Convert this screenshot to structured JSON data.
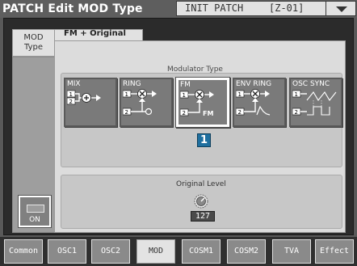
{
  "window": {
    "title": "PATCH Edit MOD Type",
    "patch_name": "INIT PATCH",
    "patch_number": "[Z-01]"
  },
  "side_tab": {
    "label_line1": "MOD",
    "label_line2": "Type"
  },
  "main_tab": {
    "label": "FM + Original"
  },
  "modulator": {
    "section_label": "Modulator Type",
    "buttons": [
      {
        "label": "MIX",
        "icon": "mix-icon"
      },
      {
        "label": "RING",
        "icon": "ring-icon"
      },
      {
        "label": "FM",
        "icon": "fm-icon",
        "selected": true
      },
      {
        "label": "ENV RING",
        "icon": "env-ring-icon"
      },
      {
        "label": "OSC SYNC",
        "icon": "osc-sync-icon"
      }
    ],
    "selected_marker": "1"
  },
  "original_level": {
    "label": "Original Level",
    "value": "127"
  },
  "switch": {
    "label": "ON"
  },
  "tabs": [
    {
      "label": "Common"
    },
    {
      "label": "OSC1"
    },
    {
      "label": "OSC2"
    },
    {
      "label": "MOD",
      "active": true
    },
    {
      "label": "COSM1"
    },
    {
      "label": "COSM2"
    },
    {
      "label": "TVA"
    },
    {
      "label": "Effect"
    }
  ],
  "colors": {
    "accent": "#1f6f9f",
    "panel": "#dcdcdc",
    "button": "#7a7a7a"
  }
}
